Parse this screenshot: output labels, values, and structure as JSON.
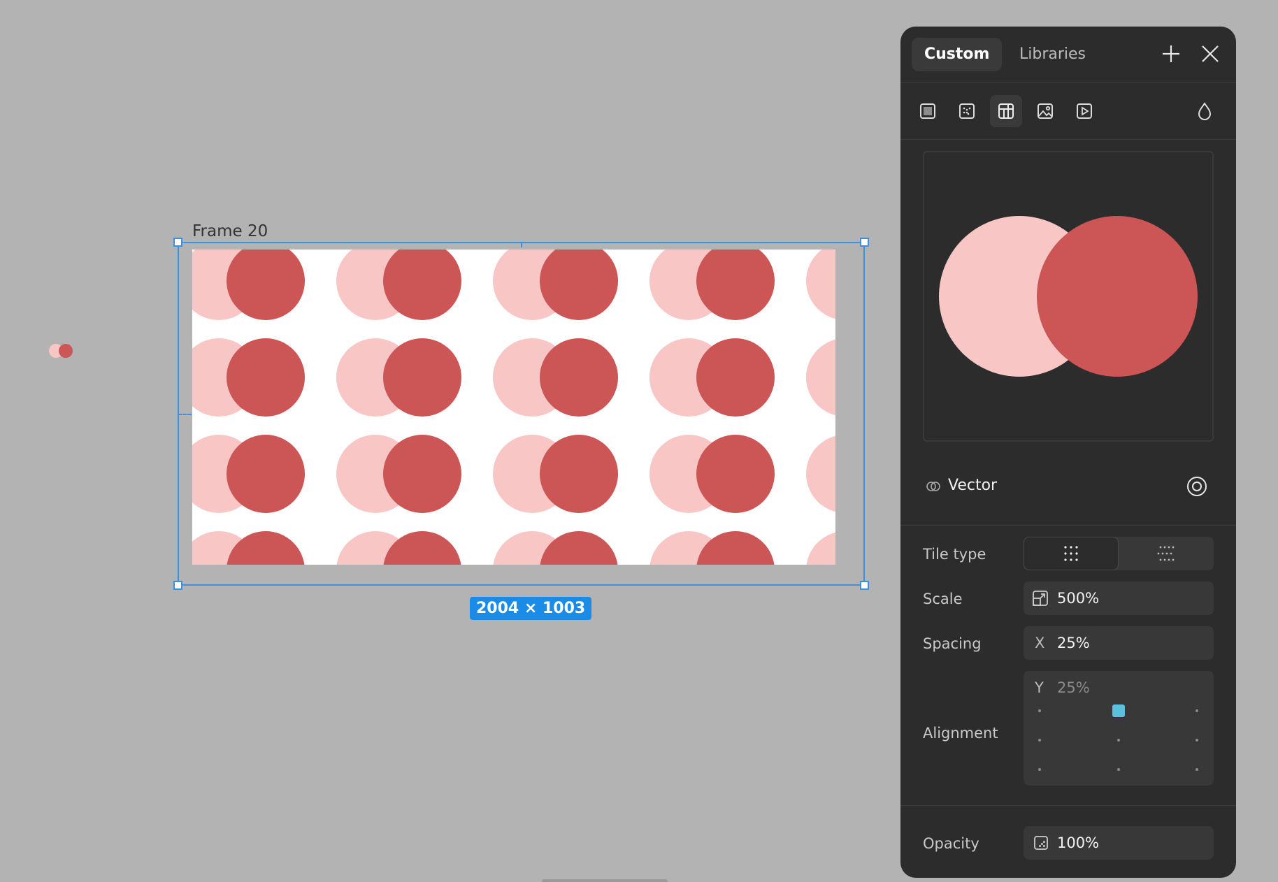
{
  "canvas": {
    "frame_label": "Frame 20",
    "size_badge": "2004 × 1003",
    "colors": {
      "light_circle": "#f9c6c6",
      "dark_circle": "#cc5555",
      "selection": "#3d8fe0"
    }
  },
  "panel": {
    "tabs": [
      {
        "label": "Custom",
        "active": true
      },
      {
        "label": "Libraries",
        "active": false
      }
    ],
    "header_icons": [
      "plus-icon",
      "close-icon"
    ],
    "fill_types": [
      {
        "name": "solid-fill-icon",
        "active": false
      },
      {
        "name": "gradient-fill-icon",
        "active": false
      },
      {
        "name": "pattern-fill-icon",
        "active": true
      },
      {
        "name": "image-fill-icon",
        "active": false
      },
      {
        "name": "video-fill-icon",
        "active": false
      }
    ],
    "blend_icon": "droplet-icon",
    "source": {
      "label": "Vector",
      "icon": "component-icon",
      "target_icon": "target-icon"
    },
    "tile_type": {
      "label": "Tile type",
      "options": [
        "grid-tile-icon",
        "brick-tile-icon"
      ],
      "selected": 0
    },
    "scale": {
      "label": "Scale",
      "value": "500%"
    },
    "spacing": {
      "label": "Spacing",
      "x_prefix": "X",
      "x_value": "25%",
      "y_prefix": "Y",
      "y_value": "25%"
    },
    "alignment": {
      "label": "Alignment",
      "selected": "top-center"
    },
    "opacity": {
      "label": "Opacity",
      "value": "100%"
    }
  }
}
